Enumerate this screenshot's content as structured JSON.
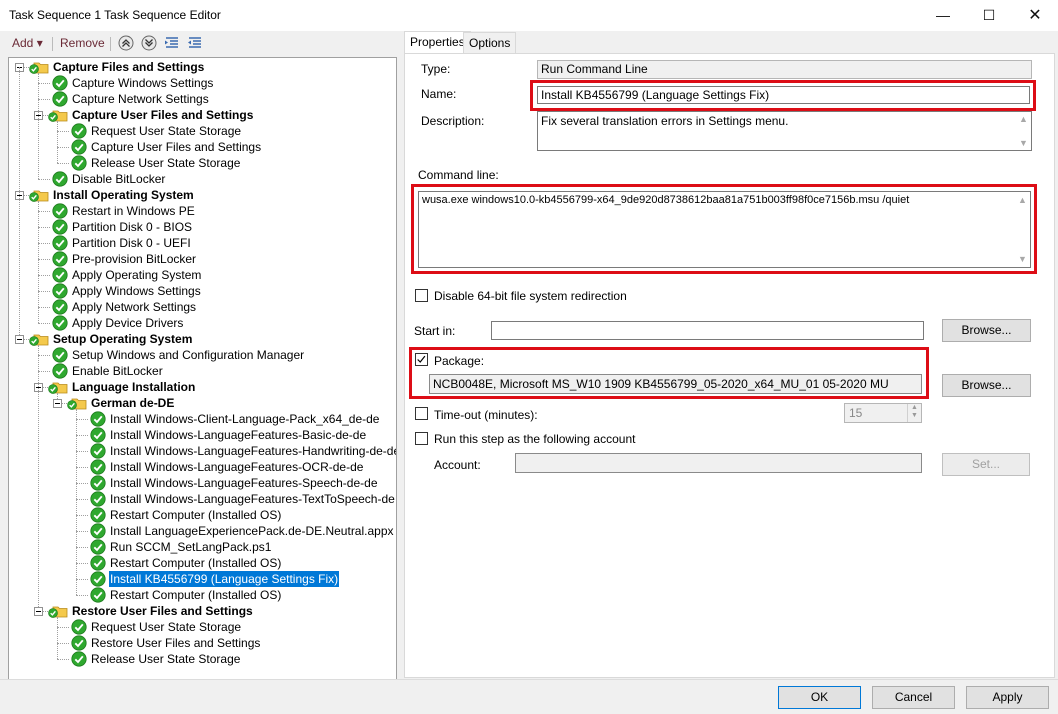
{
  "window": {
    "title": "Task Sequence 1 Task Sequence Editor"
  },
  "toolbar": {
    "add_label": "Add",
    "remove_label": "Remove"
  },
  "tabs": [
    "Properties",
    "Options"
  ],
  "tree": [
    {
      "label": "Capture Files and Settings",
      "type": "group"
    },
    {
      "label": "Capture Windows Settings",
      "type": "step"
    },
    {
      "label": "Capture Network Settings",
      "type": "step"
    },
    {
      "label": "Capture User Files and Settings",
      "type": "group"
    },
    {
      "label": "Request User State Storage",
      "type": "step"
    },
    {
      "label": "Capture User Files and Settings",
      "type": "step"
    },
    {
      "label": "Release User State Storage",
      "type": "step"
    },
    {
      "label": "Disable BitLocker",
      "type": "step"
    },
    {
      "label": "Install Operating System",
      "type": "group"
    },
    {
      "label": "Restart in Windows PE",
      "type": "step"
    },
    {
      "label": "Partition Disk 0 - BIOS",
      "type": "step"
    },
    {
      "label": "Partition Disk 0 - UEFI",
      "type": "step"
    },
    {
      "label": "Pre-provision BitLocker",
      "type": "step"
    },
    {
      "label": "Apply Operating System",
      "type": "step"
    },
    {
      "label": "Apply Windows Settings",
      "type": "step"
    },
    {
      "label": "Apply Network Settings",
      "type": "step"
    },
    {
      "label": "Apply Device Drivers",
      "type": "step"
    },
    {
      "label": "Setup Operating System",
      "type": "group"
    },
    {
      "label": "Setup Windows and Configuration Manager",
      "type": "step"
    },
    {
      "label": "Enable BitLocker",
      "type": "step"
    },
    {
      "label": "Language Installation",
      "type": "group"
    },
    {
      "label": "German de-DE",
      "type": "group"
    },
    {
      "label": "Install Windows-Client-Language-Pack_x64_de-de",
      "type": "step"
    },
    {
      "label": "Install Windows-LanguageFeatures-Basic-de-de",
      "type": "step"
    },
    {
      "label": "Install Windows-LanguageFeatures-Handwriting-de-de",
      "type": "step"
    },
    {
      "label": "Install Windows-LanguageFeatures-OCR-de-de",
      "type": "step"
    },
    {
      "label": "Install Windows-LanguageFeatures-Speech-de-de",
      "type": "step"
    },
    {
      "label": "Install Windows-LanguageFeatures-TextToSpeech-de",
      "type": "step"
    },
    {
      "label": "Restart Computer (Installed OS)",
      "type": "step"
    },
    {
      "label": "Install LanguageExperiencePack.de-DE.Neutral.appx",
      "type": "step"
    },
    {
      "label": "Run SCCM_SetLangPack.ps1",
      "type": "step"
    },
    {
      "label": "Restart Computer (Installed OS)",
      "type": "step"
    },
    {
      "label": "Install KB4556799 (Language Settings Fix)",
      "type": "step",
      "selected": true
    },
    {
      "label": "Restart Computer (Installed OS)",
      "type": "step"
    },
    {
      "label": "Restore User Files and Settings",
      "type": "group"
    },
    {
      "label": "Request User State Storage",
      "type": "step"
    },
    {
      "label": "Restore User Files and Settings",
      "type": "step"
    },
    {
      "label": "Release User State Storage",
      "type": "step"
    }
  ],
  "properties": {
    "type_label": "Type:",
    "type_value": "Run Command Line",
    "name_label": "Name:",
    "name_value": "Install KB4556799 (Language Settings Fix)",
    "description_label": "Description:",
    "description_value": "Fix several translation errors in Settings menu.",
    "command_line_label": "Command line:",
    "command_line_value": "wusa.exe windows10.0-kb4556799-x64_9de920d8738612baa81a751b003ff98f0ce7156b.msu /quiet",
    "disable_64bit_label": "Disable 64-bit file system redirection",
    "start_in_label": "Start in:",
    "start_in_value": "",
    "browse_label": "Browse...",
    "package_label": "Package:",
    "package_checked": true,
    "package_value": "NCB0048E, Microsoft MS_W10 1909 KB4556799_05-2020_x64_MU_01 05-2020 MU",
    "timeout_label": "Time-out (minutes):",
    "timeout_value": "15",
    "run_as_label": "Run this step as the following account",
    "account_label": "Account:",
    "account_value": "",
    "set_label": "Set..."
  },
  "buttons": {
    "ok": "OK",
    "cancel": "Cancel",
    "apply": "Apply"
  },
  "colors": {
    "highlight": "#dd0d16",
    "selection": "#0078d7",
    "check_green": "#2fa82f",
    "folder_yellow": "#f4c94c"
  }
}
